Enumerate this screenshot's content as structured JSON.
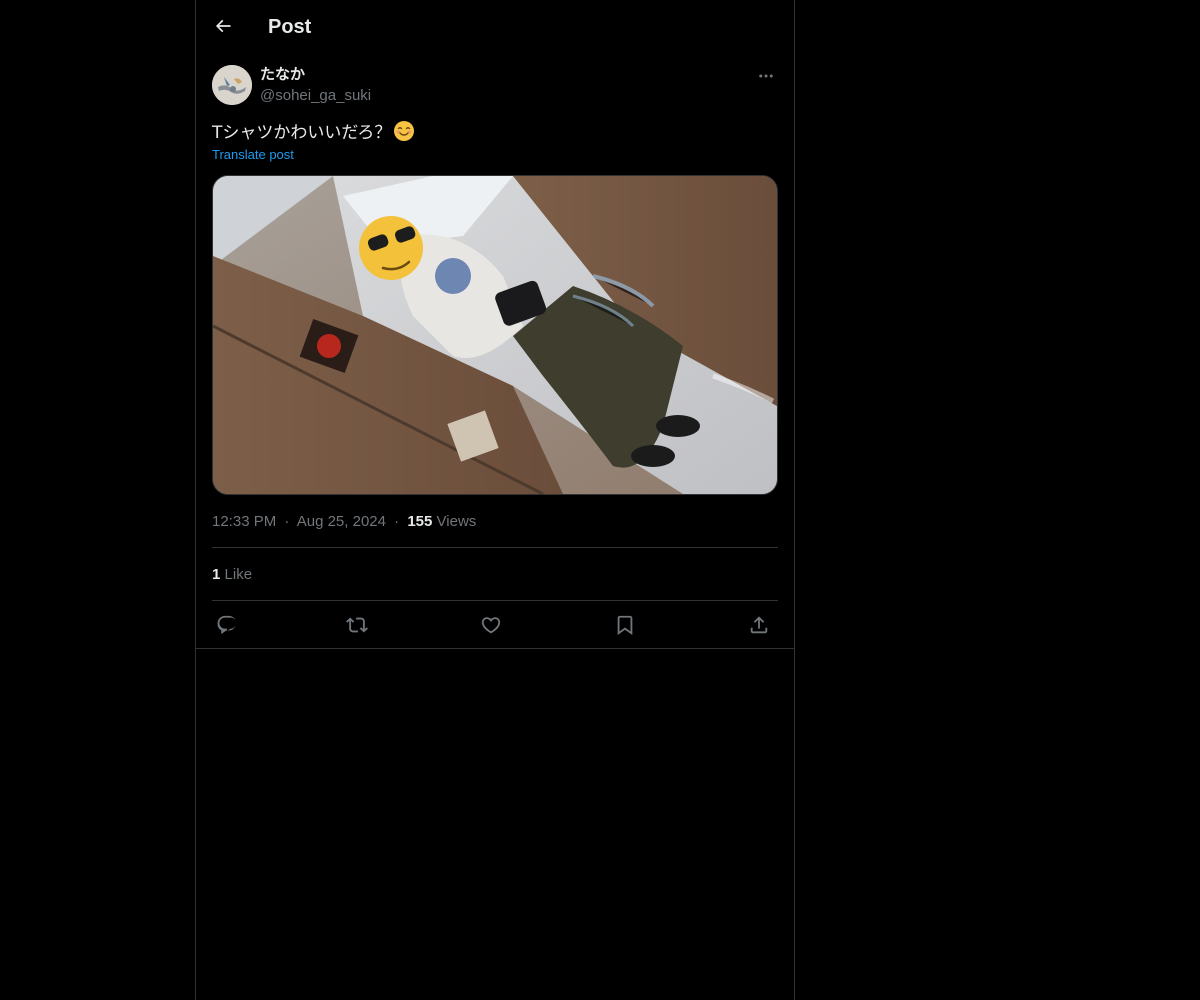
{
  "header": {
    "back_icon": "arrow-left-icon",
    "title": "Post"
  },
  "post": {
    "author": {
      "display_name": "たなか",
      "handle": "@sohei_ga_suki",
      "avatar_icon": "avatar-illustration"
    },
    "more_icon": "ellipsis-icon",
    "text": "Tシャツかわいいだろ？",
    "emoji_icon": "smiling-face-with-smiling-eyes-emoji",
    "translate_label": "Translate post",
    "media_description_icon": "photo-mirror-selfie",
    "time": "12:33 PM",
    "separator": "·",
    "date": "Aug 25, 2024",
    "views_count": "155",
    "views_label": "Views",
    "likes_count": "1",
    "likes_label": "Like",
    "actions": {
      "reply_icon": "reply-icon",
      "repost_icon": "repost-icon",
      "like_icon": "heart-icon",
      "bookmark_icon": "bookmark-icon",
      "share_icon": "share-icon"
    }
  },
  "colors": {
    "background": "#000000",
    "text_primary": "#e7e9ea",
    "text_secondary": "#71767b",
    "accent": "#1d9bf0",
    "border": "#2f3336"
  }
}
